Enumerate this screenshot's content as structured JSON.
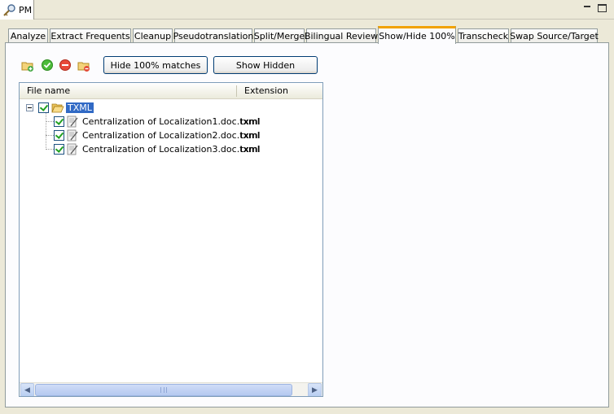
{
  "view": {
    "title": "PM",
    "icons": {
      "view": "key-search-icon",
      "minimize": "minimize-icon",
      "maximize": "maximize-icon"
    }
  },
  "tabs": [
    {
      "label": "Analyze",
      "active": false
    },
    {
      "label": "Extract Frequents",
      "active": false
    },
    {
      "label": "Cleanup",
      "active": false
    },
    {
      "label": "Pseudotranslation",
      "active": false
    },
    {
      "label": "Split/Merge",
      "active": false
    },
    {
      "label": "Bilingual Review",
      "active": false
    },
    {
      "label": "Show/Hide 100%",
      "active": true
    },
    {
      "label": "Transcheck",
      "active": false
    },
    {
      "label": "Swap Source/Target",
      "active": false
    }
  ],
  "toolbar": {
    "icons": [
      "add-folder-icon",
      "check-all-icon",
      "remove-icon",
      "remove-folder-icon"
    ],
    "hide_button": "Hide 100% matches",
    "show_button": "Show Hidden"
  },
  "tree": {
    "columns": {
      "file_name": "File name",
      "extension": "Extension"
    },
    "root": {
      "label": "TXML",
      "checked": true,
      "expanded": true
    },
    "files": [
      {
        "name": "Centralization of Localization1.doc.txml",
        "extension": "txml",
        "checked": true
      },
      {
        "name": "Centralization of Localization2.doc.txml",
        "extension": "txml",
        "checked": true
      },
      {
        "name": "Centralization of Localization3.doc.txml",
        "extension": "txml",
        "checked": true
      }
    ]
  },
  "colors": {
    "accent_tab": "#f1a200",
    "selection": "#316ac5",
    "button_border": "#003c74"
  }
}
